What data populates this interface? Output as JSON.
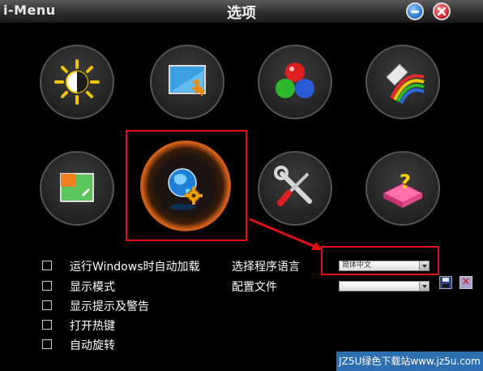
{
  "window": {
    "app_name": "i-Menu",
    "title": "选项",
    "buttons": {
      "minimize": "minimize-icon",
      "close": "close-icon"
    }
  },
  "tiles": [
    {
      "id": "brightness",
      "icon": "brightness-contrast-icon"
    },
    {
      "id": "display",
      "icon": "screen-resize-icon"
    },
    {
      "id": "color",
      "icon": "color-balls-icon"
    },
    {
      "id": "paint",
      "icon": "paint-bucket-icon"
    },
    {
      "id": "image",
      "icon": "image-crop-icon"
    },
    {
      "id": "language",
      "icon": "globe-gear-icon",
      "selected": true
    },
    {
      "id": "tools",
      "icon": "wrench-screwdriver-icon"
    },
    {
      "id": "help",
      "icon": "help-box-icon"
    }
  ],
  "options": [
    {
      "label": "运行Windows时自动加载",
      "checked": false
    },
    {
      "label": "显示模式",
      "checked": false
    },
    {
      "label": "显示提示及警告",
      "checked": false
    },
    {
      "label": "打开热键",
      "checked": false
    },
    {
      "label": "自动旋转",
      "checked": false
    }
  ],
  "language": {
    "label": "选择程序语言",
    "value": "简体中文"
  },
  "config": {
    "label": "配置文件",
    "value": ""
  },
  "watermark": "JZ5U绿色下载站www.jz5u.com",
  "colors": {
    "highlight": "#e01010",
    "background": "#000000",
    "accent_orange": "#d8621a"
  }
}
